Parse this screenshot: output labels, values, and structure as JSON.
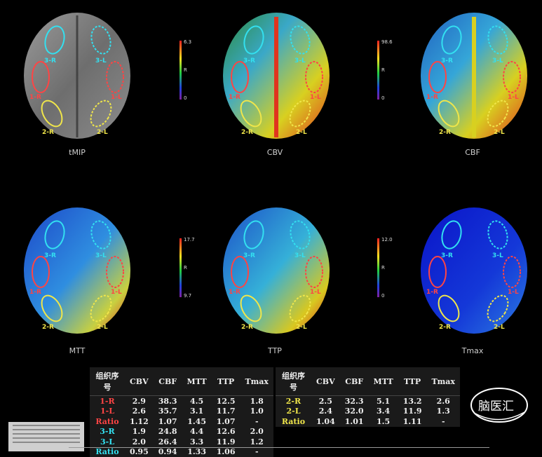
{
  "panels": [
    {
      "id": "tmip",
      "caption": "tMIP"
    },
    {
      "id": "cbv",
      "caption": "CBV"
    },
    {
      "id": "cbf",
      "caption": "CBF"
    },
    {
      "id": "mtt",
      "caption": "MTT"
    },
    {
      "id": "ttp",
      "caption": "TTP"
    },
    {
      "id": "tmax",
      "caption": "Tmax"
    }
  ],
  "colorbars": [
    {
      "max": "6.3",
      "mid": "R",
      "min": "0"
    },
    {
      "max": "98.6",
      "mid": "R",
      "min": "0"
    },
    {
      "max": "17.7",
      "mid": "R",
      "min": "9.7"
    },
    {
      "max": "12.0",
      "mid": "R",
      "min": "0"
    }
  ],
  "roi_labels": {
    "r3": "3-R",
    "l3": "3-L",
    "r1": "1-R",
    "l1": "1-L",
    "r2": "2-R",
    "l2": "2-L"
  },
  "table_left": {
    "headers": [
      "组织序号",
      "CBV",
      "CBF",
      "MTT",
      "TTP",
      "Tmax"
    ],
    "rows": [
      [
        "1-R",
        "2.9",
        "38.3",
        "4.5",
        "12.5",
        "1.8"
      ],
      [
        "1-L",
        "2.6",
        "35.7",
        "3.1",
        "11.7",
        "1.0"
      ],
      [
        "Ratio",
        "1.12",
        "1.07",
        "1.45",
        "1.07",
        "-"
      ],
      [
        "3-R",
        "1.9",
        "24.8",
        "4.4",
        "12.6",
        "2.0"
      ],
      [
        "3-L",
        "2.0",
        "26.4",
        "3.3",
        "11.9",
        "1.2"
      ],
      [
        "Ratio",
        "0.95",
        "0.94",
        "1.33",
        "1.06",
        "-"
      ]
    ]
  },
  "table_right": {
    "headers": [
      "组织序号",
      "CBV",
      "CBF",
      "MTT",
      "TTP",
      "Tmax"
    ],
    "rows": [
      [
        "2-R",
        "2.5",
        "32.3",
        "5.1",
        "13.2",
        "2.6"
      ],
      [
        "2-L",
        "2.4",
        "32.0",
        "3.4",
        "11.9",
        "1.3"
      ],
      [
        "Ratio",
        "1.04",
        "1.01",
        "1.5",
        "1.11",
        "-"
      ]
    ]
  },
  "logo": {
    "text": "脑医汇"
  },
  "colors": {
    "roi_red": "#ff4444",
    "roi_cyan": "#33e0f0",
    "roi_yellow": "#f0e64a"
  }
}
